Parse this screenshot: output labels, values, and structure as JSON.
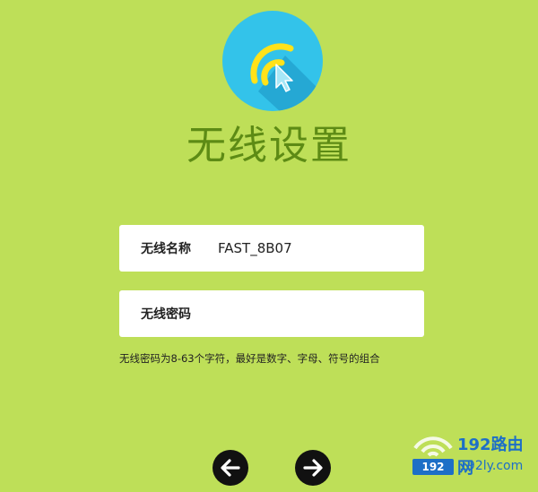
{
  "page": {
    "title": "无线设置"
  },
  "form": {
    "ssid_label": "无线名称",
    "ssid_value": "FAST_8B07",
    "password_label": "无线密码",
    "password_value": "",
    "hint": "无线密码为8-63个字符，最好是数字、字母、符号的组合"
  },
  "nav": {
    "back_icon": "arrow-left-icon",
    "next_icon": "arrow-right-icon"
  },
  "watermark": {
    "title": "192路由网",
    "badge": "192",
    "subtitle": "192ly.com"
  },
  "colors": {
    "background": "#bedf58",
    "title": "#5d8b15",
    "logo": "#33c3ea",
    "nav_button": "#111111",
    "watermark": "#1d6fc7"
  }
}
